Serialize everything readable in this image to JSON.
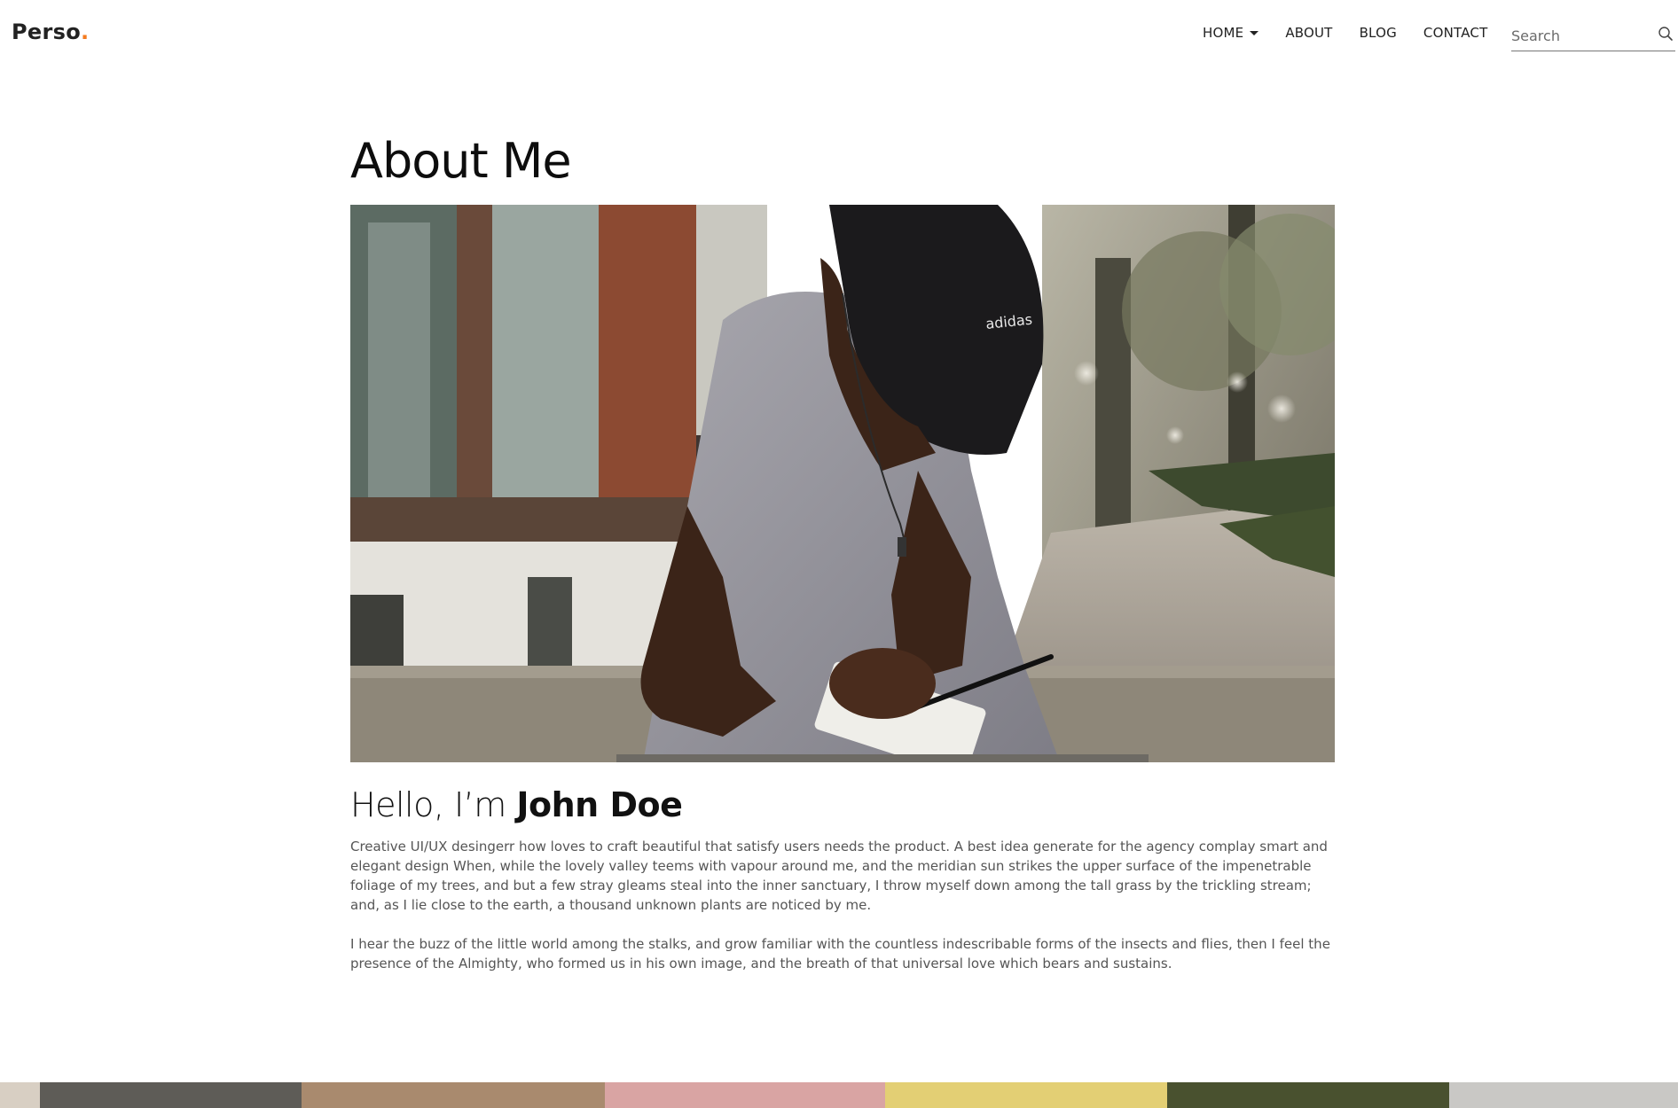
{
  "brand": {
    "name": "Perso",
    "dot": "."
  },
  "nav": {
    "items": [
      {
        "label": "HOME",
        "has_dropdown": true
      },
      {
        "label": "ABOUT"
      },
      {
        "label": "BLOG"
      },
      {
        "label": "CONTACT"
      }
    ],
    "search_placeholder": "Search"
  },
  "page": {
    "title": "About Me",
    "greeting_prefix": "Hello, I’m ",
    "greeting_name": "John Doe",
    "paragraphs": [
      "Creative UI/UX desingerr how loves to craft beautiful that satisfy users needs the product. A best idea generate for the agency complay smart and elegant design When, while the lovely valley teems with vapour around me, and the meridian sun strikes the upper surface of the impenetrable foliage of my trees, and but a few stray gleams steal into the inner sanctuary, I throw myself down among the tall grass by the trickling stream; and, as I lie close to the earth, a thousand unknown plants are noticed by me.",
      "I hear the buzz of the little world among the stalks, and grow familiar with the countless indescribable forms of the insects and flies, then I feel the presence of the Almighty, who formed us in his own image, and the breath of that universal love which bears and sustains."
    ]
  },
  "colors": {
    "accent": "#f47b20",
    "text": "#222222",
    "body_text": "#555555"
  },
  "icons": {
    "search": "search-icon",
    "caret": "caret-down-icon"
  }
}
